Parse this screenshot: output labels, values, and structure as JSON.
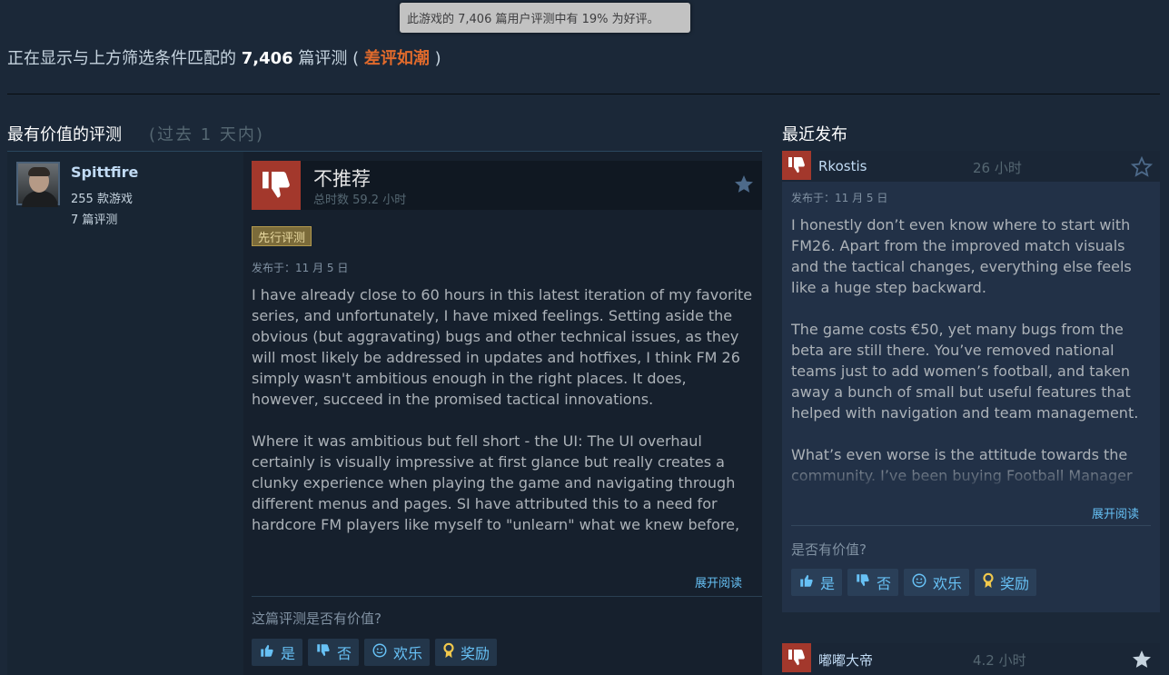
{
  "tooltip": {
    "text": "此游戏的 7,406 篇用户评测中有 19% 为好评。"
  },
  "summary": {
    "prefix": "正在显示与上方筛选条件匹配的 ",
    "count": "7,406",
    "mid": " 篇评测 ( ",
    "rating": "差评如潮",
    "suffix": " )"
  },
  "sections": {
    "helpful_title": "最有价值的评测",
    "helpful_period": "(过去 1 天内)",
    "recent_title": "最近发布"
  },
  "main_review": {
    "author": {
      "name": "Spittfire",
      "games": "255 款游戏",
      "reviews": "7 篇评测"
    },
    "verdict": "不推荐",
    "hours": "总时数 59.2 小时",
    "badge": "先行评测",
    "posted": "发布于：11 月 5 日",
    "paragraphs": [
      "I have already close to 60 hours in this latest iteration of my favorite series, and unfortunately, I have mixed feelings. Setting aside the obvious (but aggravating) bugs and other technical issues, as they will most likely be addressed in updates and hotfixes, I think FM 26 simply wasn't ambitious enough in the right places. It does, however, succeed in the promised tactical innovations.",
      "Where it was ambitious but fell short - the UI: The UI overhaul certainly is visually impressive at first glance but really creates a clunky experience when playing the game and navigating through different menus and pages. SI have attributed this to a need for hardcore FM players like myself to \"unlearn\" what we knew before,"
    ],
    "read_more": "展开阅读",
    "helpful_question": "这篇评测是否有价值?",
    "buttons": {
      "yes": "是",
      "no": "否",
      "funny": "欢乐",
      "award": "奖励"
    }
  },
  "recent_review": {
    "author": "Rkostis",
    "hours": "26 小时",
    "posted": "发布于：11 月 5 日",
    "paragraphs": [
      "I honestly don’t even know where to start with FM26. Apart from the improved match visuals and the tactical changes, everything else feels like a huge step backward.",
      "The game costs €50, yet many bugs from the beta are still there. You’ve removed national teams just to add women’s football, and taken away a bunch of small but useful features that helped with navigation and team management.",
      "What’s even worse is the attitude towards the community. I’ve been buying Football Manager"
    ],
    "read_more": "展开阅读",
    "helpful_question": "是否有价值?",
    "buttons": {
      "yes": "是",
      "no": "否",
      "funny": "欢乐",
      "award": "奖励"
    }
  },
  "recent_review_2": {
    "author": "嘟嘟大帝",
    "hours": "4.2 小时"
  },
  "colors": {
    "background": "#1b2838",
    "thumbs_down": "#a3382c",
    "rating_negative": "#e06a2c",
    "link": "#66c0f4"
  }
}
